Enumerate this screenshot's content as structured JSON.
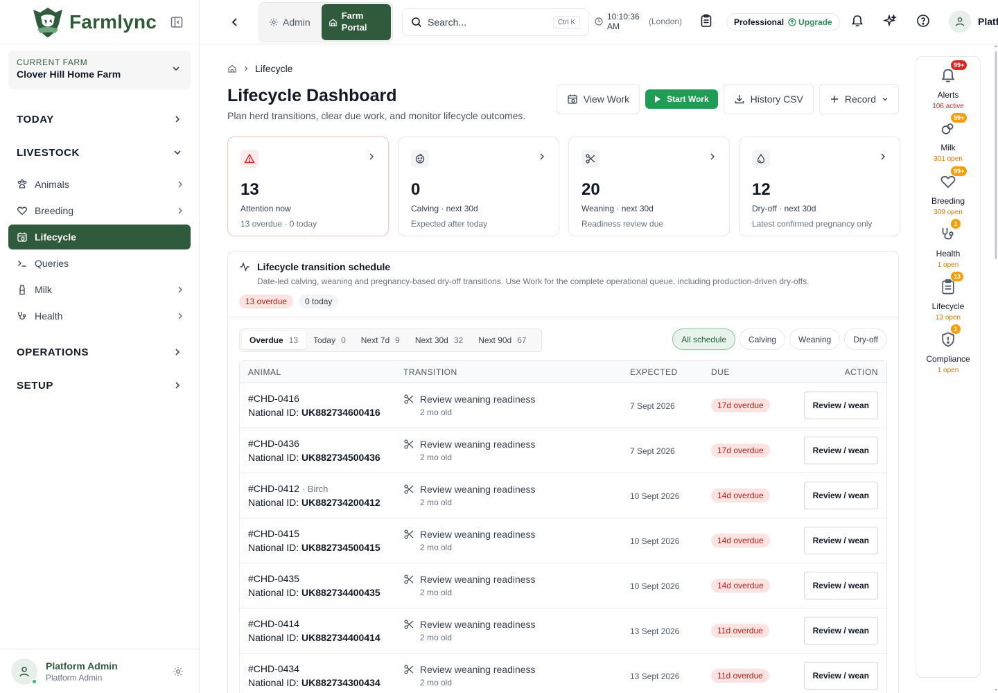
{
  "brand": {
    "name": "Farmlync"
  },
  "farm": {
    "label": "CURRENT FARM",
    "name": "Clover Hill Home Farm"
  },
  "nav": {
    "today": "TODAY",
    "livestock": "LIVESTOCK",
    "items": [
      {
        "label": "Animals"
      },
      {
        "label": "Breeding"
      },
      {
        "label": "Lifecycle"
      },
      {
        "label": "Queries"
      },
      {
        "label": "Milk"
      },
      {
        "label": "Health"
      }
    ],
    "operations": "OPERATIONS",
    "setup": "SETUP"
  },
  "user": {
    "name": "Platform Admin",
    "role": "Platform Admin"
  },
  "topbar": {
    "admin_label": "Admin",
    "farm_portal_label": "Farm Portal",
    "search_placeholder": "Search...",
    "search_shortcut": "Ctrl K",
    "time": "10:10:36 AM",
    "timezone": "(London)",
    "plan": "Professional",
    "upgrade": "Upgrade",
    "user_short": "Platf"
  },
  "page": {
    "breadcrumb": "Lifecycle",
    "title": "Lifecycle Dashboard",
    "subtitle": "Plan herd transitions, clear due work, and monitor lifecycle outcomes.",
    "actions": {
      "view_work": "View Work",
      "start_work": "Start Work",
      "history_csv": "History CSV",
      "record": "Record"
    }
  },
  "cards": [
    {
      "value": "13",
      "label": "Attention now",
      "sub": "13 overdue · 0 today",
      "icon": "warning-icon"
    },
    {
      "value": "0",
      "label": "Calving · next 30d",
      "sub": "Expected after today",
      "icon": "calving-icon"
    },
    {
      "value": "20",
      "label": "Weaning · next 30d",
      "sub": "Readiness review due",
      "icon": "scissors-icon"
    },
    {
      "value": "12",
      "label": "Dry-off · next 30d",
      "sub": "Latest confirmed pregnancy only",
      "icon": "droplet-icon"
    }
  ],
  "schedule": {
    "title": "Lifecycle transition schedule",
    "desc": "Date-led calving, weaning and pregnancy-based dry-off transitions. Use Work for the complete operational queue, including production-driven dry-offs.",
    "pill_overdue": "13 overdue",
    "pill_today": "0 today",
    "tabs": [
      {
        "label": "Overdue",
        "count": "13"
      },
      {
        "label": "Today",
        "count": "0"
      },
      {
        "label": "Next 7d",
        "count": "9"
      },
      {
        "label": "Next 30d",
        "count": "32"
      },
      {
        "label": "Next 90d",
        "count": "67"
      }
    ],
    "filters": [
      "All schedule",
      "Calving",
      "Weaning",
      "Dry-off"
    ],
    "columns": {
      "animal": "ANIMAL",
      "transition": "TRANSITION",
      "expected": "EXPECTED",
      "due": "DUE",
      "action": "ACTION"
    },
    "national_prefix": "National ID:",
    "rows": [
      {
        "id": "#CHD-0416",
        "nick": "",
        "national": "UK882734600416",
        "transition": "Review weaning readiness",
        "age": "2 mo old",
        "expected": "7 Sept 2026",
        "due": "17d overdue",
        "action": "Review / wean"
      },
      {
        "id": "#CHD-0436",
        "nick": "",
        "national": "UK882734500436",
        "transition": "Review weaning readiness",
        "age": "2 mo old",
        "expected": "7 Sept 2026",
        "due": "17d overdue",
        "action": "Review / wean"
      },
      {
        "id": "#CHD-0412",
        "nick": "· Birch",
        "national": "UK882734200412",
        "transition": "Review weaning readiness",
        "age": "2 mo old",
        "expected": "10 Sept 2026",
        "due": "14d overdue",
        "action": "Review / wean"
      },
      {
        "id": "#CHD-0415",
        "nick": "",
        "national": "UK882734500415",
        "transition": "Review weaning readiness",
        "age": "2 mo old",
        "expected": "10 Sept 2026",
        "due": "14d overdue",
        "action": "Review / wean"
      },
      {
        "id": "#CHD-0435",
        "nick": "",
        "national": "UK882734400435",
        "transition": "Review weaning readiness",
        "age": "2 mo old",
        "expected": "10 Sept 2026",
        "due": "14d overdue",
        "action": "Review / wean"
      },
      {
        "id": "#CHD-0414",
        "nick": "",
        "national": "UK882734400414",
        "transition": "Review weaning readiness",
        "age": "2 mo old",
        "expected": "13 Sept 2026",
        "due": "11d overdue",
        "action": "Review / wean"
      },
      {
        "id": "#CHD-0434",
        "nick": "",
        "national": "UK882734300434",
        "transition": "Review weaning readiness",
        "age": "2 mo old",
        "expected": "13 Sept 2026",
        "due": "11d overdue",
        "action": "Review / wean"
      }
    ]
  },
  "rail": [
    {
      "label": "Alerts",
      "badge": "99+",
      "sub": "106 active",
      "icon": "bell-icon",
      "badge_color": "#dc2626"
    },
    {
      "label": "Milk",
      "badge": "99+",
      "sub": "301 open",
      "icon": "milk-icon",
      "badge_color": "#f59e0b"
    },
    {
      "label": "Breeding",
      "badge": "99+",
      "sub": "309 open",
      "icon": "heart-icon",
      "badge_color": "#f59e0b"
    },
    {
      "label": "Health",
      "badge": "1",
      "sub": "1 open",
      "icon": "stethoscope-icon",
      "badge_color": "#f59e0b"
    },
    {
      "label": "Lifecycle",
      "badge": "13",
      "sub": "13 open",
      "icon": "clipboard-icon",
      "badge_color": "#f59e0b"
    },
    {
      "label": "Compliance",
      "badge": "1",
      "sub": "1 open",
      "icon": "shield-icon",
      "badge_color": "#f59e0b"
    }
  ],
  "colors": {
    "brand": "#2f5a3b",
    "primary": "#1f9d55",
    "danger": "#dc2626",
    "warning": "#f59e0b"
  }
}
